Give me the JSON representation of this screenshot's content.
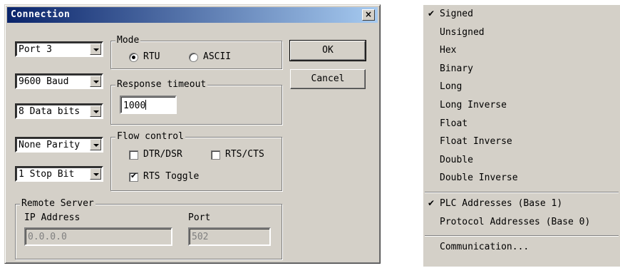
{
  "dialog": {
    "title": "Connection",
    "close_glyph": "×",
    "port": "Port 3",
    "baud": "9600 Baud",
    "data_bits": "8 Data bits",
    "parity": "None Parity",
    "stop_bits": "1 Stop Bit",
    "mode": {
      "legend": "Mode",
      "rtu": "RTU",
      "ascii": "ASCII",
      "selected": "RTU"
    },
    "response_timeout": {
      "legend": "Response timeout",
      "value": "1000"
    },
    "flow_control": {
      "legend": "Flow control",
      "dtr_dsr": "DTR/DSR",
      "rts_cts": "RTS/CTS",
      "rts_toggle": "RTS Toggle"
    },
    "remote_server": {
      "legend": "Remote Server",
      "ip_label": "IP Address",
      "ip_value": "0.0.0.0",
      "port_label": "Port",
      "port_value": "502"
    },
    "ok_label": "OK",
    "cancel_label": "Cancel"
  },
  "menu": {
    "check_glyph": "✔",
    "formats": [
      {
        "label": "Signed",
        "checked": true
      },
      {
        "label": "Unsigned",
        "checked": false
      },
      {
        "label": "Hex",
        "checked": false
      },
      {
        "label": "Binary",
        "checked": false
      },
      {
        "label": "Long",
        "checked": false
      },
      {
        "label": "Long Inverse",
        "checked": false
      },
      {
        "label": "Float",
        "checked": false
      },
      {
        "label": "Float Inverse",
        "checked": false
      },
      {
        "label": "Double",
        "checked": false
      },
      {
        "label": "Double Inverse",
        "checked": false
      }
    ],
    "addressing": [
      {
        "label": "PLC Addresses (Base 1)",
        "checked": true
      },
      {
        "label": "Protocol Addresses (Base 0)",
        "checked": false
      }
    ],
    "communication": "Communication..."
  }
}
